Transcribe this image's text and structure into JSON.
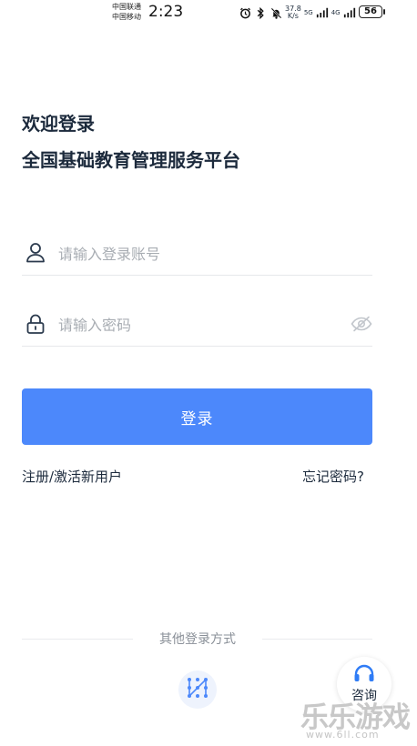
{
  "status_bar": {
    "carrier_1": "中国联通",
    "carrier_2": "中国移动",
    "time": "2:23",
    "speed_value": "37.8",
    "speed_unit": "K/s",
    "net_1": "5G",
    "net_2": "4G",
    "battery": "56"
  },
  "header": {
    "welcome": "欢迎登录",
    "platform_name": "全国基础教育管理服务平台"
  },
  "form": {
    "account_placeholder": "请输入登录账号",
    "password_placeholder": "请输入密码",
    "login_label": "登录"
  },
  "links": {
    "register": "注册/激活新用户",
    "forgot": "忘记密码?"
  },
  "other_login": {
    "label": "其他登录方式"
  },
  "consult": {
    "label": "咨询"
  },
  "watermark": {
    "text": "乐乐游戏",
    "url": "www.6ll.com"
  },
  "colors": {
    "primary": "#4c88fb",
    "text": "#1c2a3c",
    "placeholder": "#a8adb3"
  }
}
